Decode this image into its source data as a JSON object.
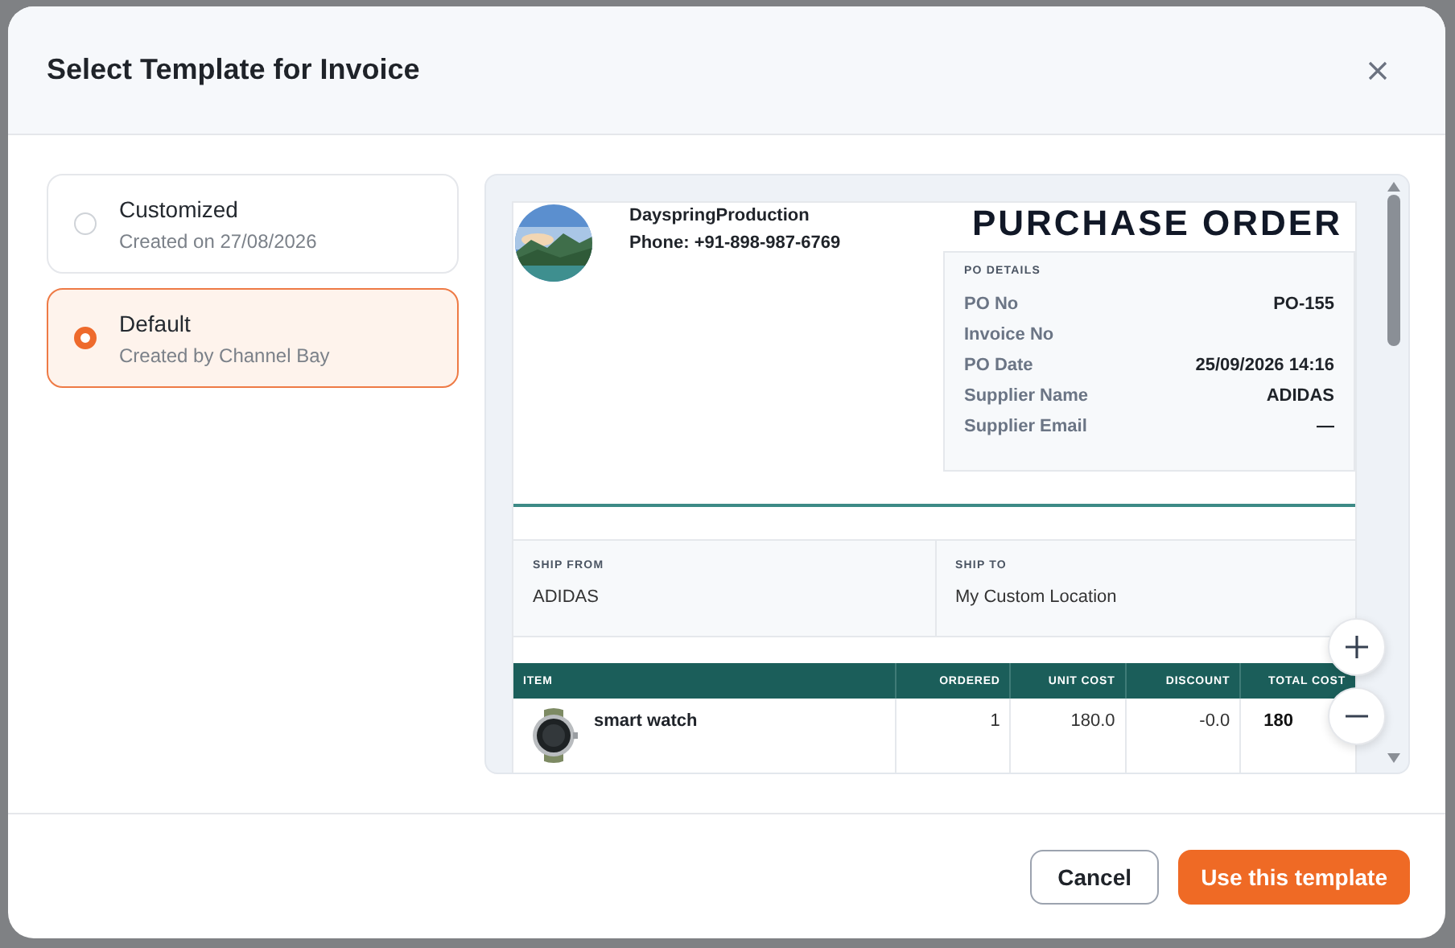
{
  "modal": {
    "title": "Select Template for Invoice"
  },
  "templates": [
    {
      "name": "Customized",
      "subtitle": "Created on 27/08/2026",
      "selected": false
    },
    {
      "name": "Default",
      "subtitle": "Created by Channel Bay",
      "selected": true
    }
  ],
  "preview": {
    "company": "DayspringProduction",
    "phone": "Phone: +91-898-987-6769",
    "doc_title": "PURCHASE ORDER",
    "po_details": {
      "heading": "PO DETAILS",
      "rows": [
        {
          "label": "PO No",
          "value": "PO-155"
        },
        {
          "label": "Invoice No"
        },
        {
          "label": "PO Date",
          "value": "25/09/2026 14:16"
        },
        {
          "label": "Supplier Name",
          "value": "ADIDAS"
        },
        {
          "label": "Supplier Email",
          "value": "—"
        }
      ]
    },
    "ship": [
      {
        "label": "SHIP FROM",
        "value": "ADIDAS"
      },
      {
        "label": "SHIP TO",
        "value": "My Custom Location"
      }
    ],
    "table": {
      "columns": [
        "ITEM",
        "ORDERED",
        "UNIT COST",
        "DISCOUNT",
        "TOTAL COST"
      ],
      "rows": [
        {
          "item": "smart watch",
          "ordered": "1",
          "unit_cost": "180.0",
          "discount": "-0.0",
          "total_cost": "180"
        }
      ]
    }
  },
  "buttons": {
    "cancel": "Cancel",
    "confirm": "Use this template"
  }
}
